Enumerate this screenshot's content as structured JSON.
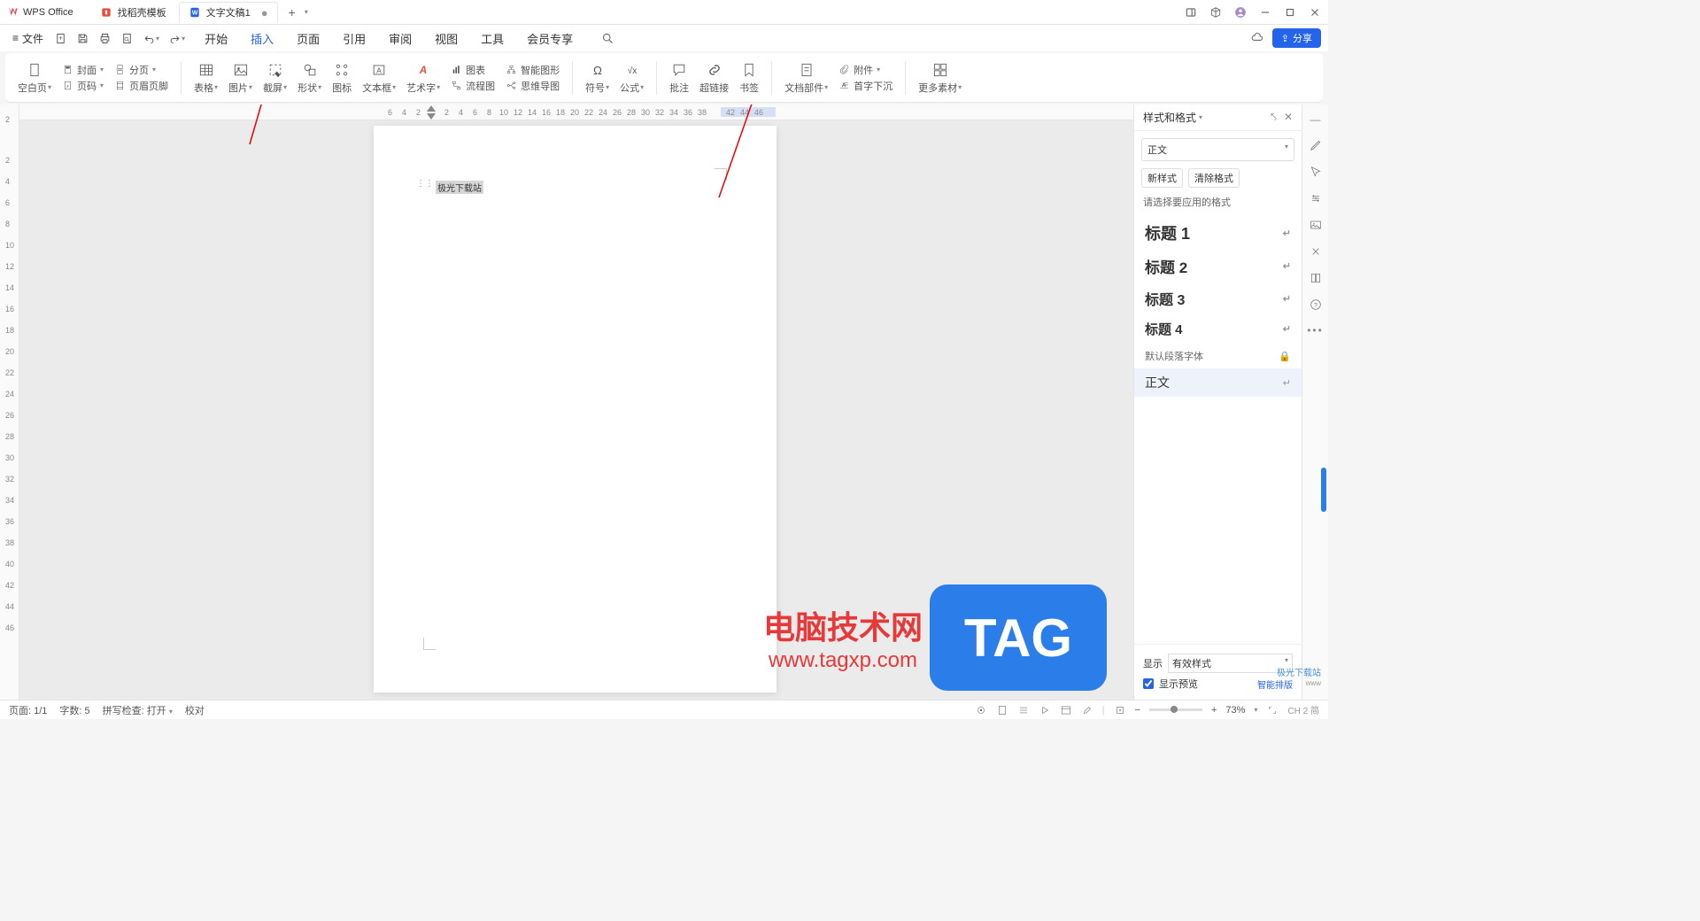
{
  "app": {
    "name": "WPS Office"
  },
  "tabs": [
    {
      "label": "找稻壳模板",
      "icon_color": "#e84c3d"
    },
    {
      "label": "文字文稿1",
      "icon_color": "#2663eb",
      "active": true
    }
  ],
  "file_menu": "文件",
  "menu_tabs": [
    "开始",
    "插入",
    "页面",
    "引用",
    "审阅",
    "视图",
    "工具",
    "会员专享"
  ],
  "menu_tab_active": "插入",
  "share_btn": "分享",
  "ribbon": {
    "blank_page": "空白页",
    "cover": "封面",
    "page_num": "页码",
    "page_break": "分页",
    "header_footer": "页眉页脚",
    "table": "表格",
    "picture": "图片",
    "screenshot": "截屏",
    "shapes": "形状",
    "icons": "图标",
    "textbox": "文本框",
    "wordart": "艺术字",
    "chart": "图表",
    "flowchart": "流程图",
    "smartart": "智能图形",
    "mindmap": "思维导图",
    "symbol": "符号",
    "equation": "公式",
    "comment": "批注",
    "hyperlink": "超链接",
    "bookmark": "书签",
    "doc_parts": "文档部件",
    "attachment": "附件",
    "drop_cap": "首字下沉",
    "more_assets": "更多素材"
  },
  "ruler_h": [
    "6",
    "4",
    "2",
    "",
    "2",
    "4",
    "6",
    "8",
    "10",
    "12",
    "14",
    "16",
    "18",
    "20",
    "22",
    "24",
    "26",
    "28",
    "30",
    "32",
    "34",
    "36",
    "38",
    "",
    "42",
    "44",
    "46"
  ],
  "ruler_v": [
    "2",
    "2",
    "4",
    "6",
    "8",
    "10",
    "12",
    "14",
    "16",
    "18",
    "20",
    "22",
    "24",
    "26",
    "28",
    "30",
    "32",
    "34",
    "36",
    "38",
    "40",
    "42",
    "44",
    "46"
  ],
  "page_text": "极光下载站",
  "sidebar": {
    "title": "样式和格式",
    "dropdown": "正文",
    "btn_new_style": "新样式",
    "btn_clear": "清除格式",
    "hint": "请选择要应用的格式",
    "styles": [
      {
        "label": "标题 1",
        "class": "h1"
      },
      {
        "label": "标题 2",
        "class": "h2"
      },
      {
        "label": "标题 3",
        "class": "h3"
      },
      {
        "label": "标题 4",
        "class": "h4"
      },
      {
        "label": "默认段落字体",
        "class": "small",
        "lock": true
      },
      {
        "label": "正文",
        "class": "",
        "selected": true
      }
    ],
    "display_label": "显示",
    "display_value": "有效样式",
    "preview_check": "显示预览",
    "smart_layout": "智能排版"
  },
  "statusbar": {
    "page": "页面: 1/1",
    "words": "字数: 5",
    "spell": "拼写检查: 打开",
    "proof": "校对",
    "zoom": "73%",
    "ime_badge": "CH 2 简"
  },
  "watermark": {
    "line1": "电脑技术网",
    "line2": "www.tagxp.com",
    "tag": "TAG",
    "small": "极光下载站",
    "small_sub": "www"
  }
}
